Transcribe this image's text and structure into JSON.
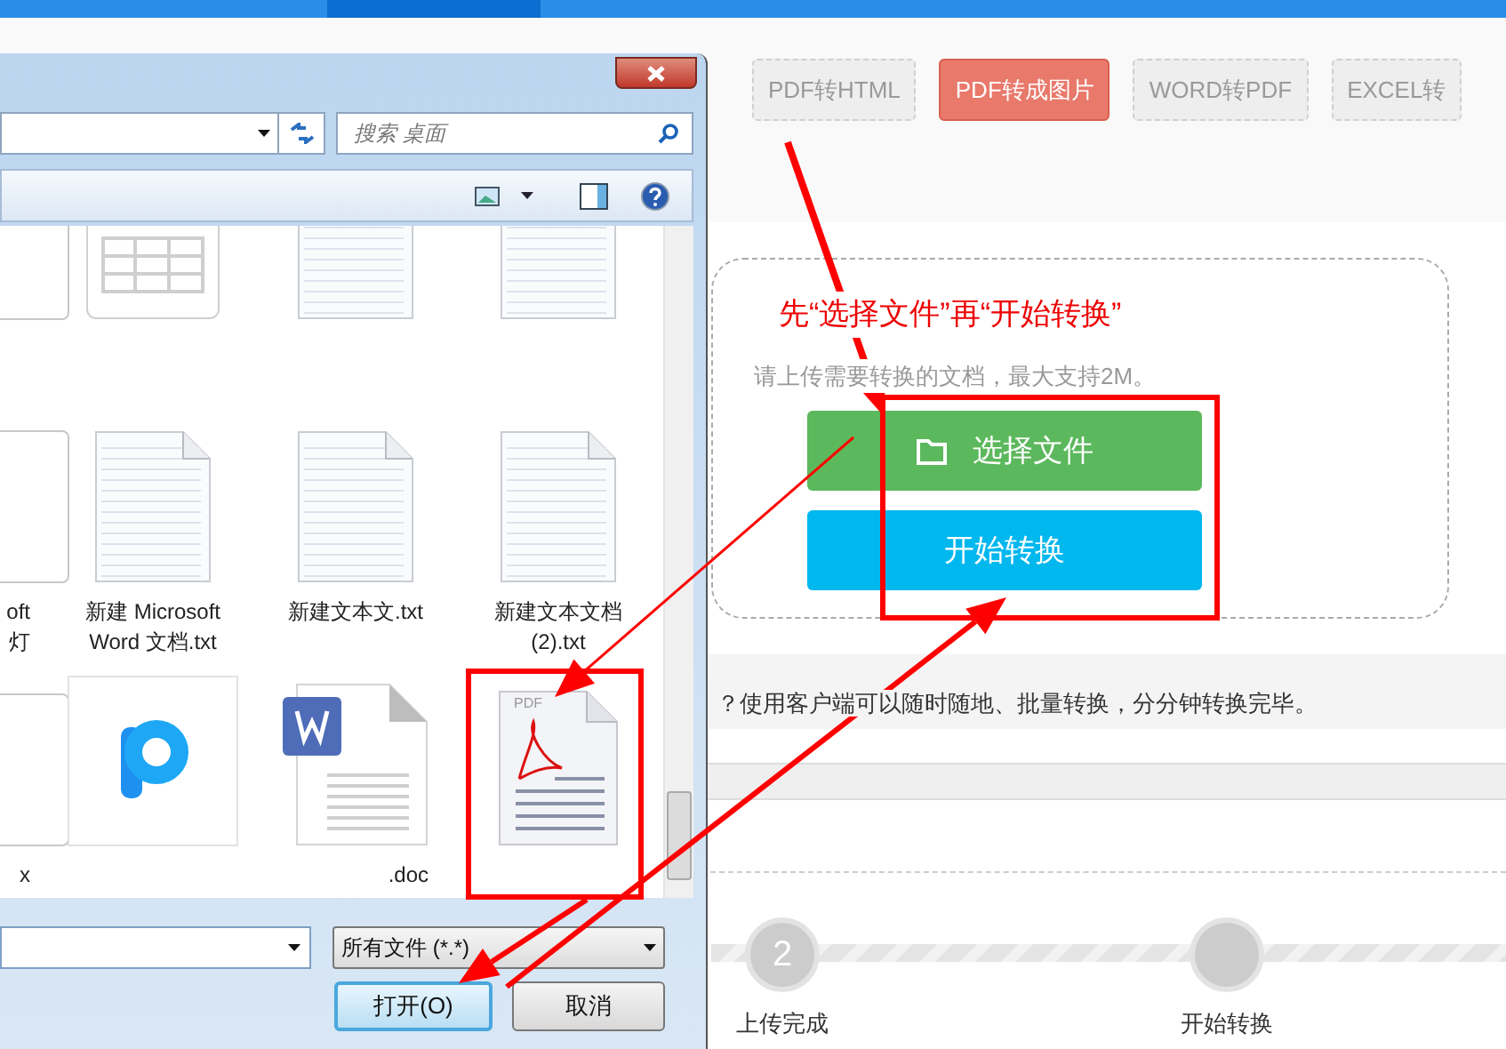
{
  "page": {
    "tabs": [
      {
        "label": "PDF转HTML",
        "selected": false
      },
      {
        "label": "PDF转成图片",
        "selected": true
      },
      {
        "label": "WORD转PDF",
        "selected": false
      },
      {
        "label": "EXCEL转",
        "selected": false
      }
    ],
    "upload": {
      "instruction": "先“选择文件”再“开始转换”",
      "hint": "请上传需要转换的文档，最大支持2M。",
      "buttons": [
        {
          "label": "选择文件",
          "kind": "choose"
        },
        {
          "label": "开始转换",
          "kind": "start"
        }
      ]
    },
    "notice": "？使用客户端可以随时随地、批量转换，分分钟转换完毕。",
    "steps": [
      {
        "number": "2",
        "label": "上传完成"
      },
      {
        "label": "开始转换"
      }
    ]
  },
  "dialog": {
    "search_placeholder": "搜索 桌面",
    "files": [
      {
        "kind": "partial"
      },
      {
        "kind": "sheet"
      },
      {
        "kind": "text"
      },
      {
        "kind": "text"
      },
      {
        "kind": "partial",
        "lines": [
          "oft",
          "灯"
        ]
      },
      {
        "kind": "text",
        "lines": [
          "新建 Microsoft",
          "Word 文档.txt"
        ]
      },
      {
        "kind": "text",
        "lines": [
          "新建文本文.txt"
        ]
      },
      {
        "kind": "text",
        "lines": [
          "新建文本文档",
          "(2).txt"
        ]
      },
      {
        "kind": "partial",
        "lines": [
          "x"
        ]
      },
      {
        "kind": "app"
      },
      {
        "kind": "word",
        "lines": [
          ".doc"
        ]
      },
      {
        "kind": "pdf",
        "icon_text": "PDF"
      }
    ],
    "file_type": "所有文件 (*.*)",
    "buttons": [
      {
        "label": "打开(O)",
        "kind": "primary"
      },
      {
        "label": "取消",
        "kind": "secondary"
      }
    ]
  }
}
